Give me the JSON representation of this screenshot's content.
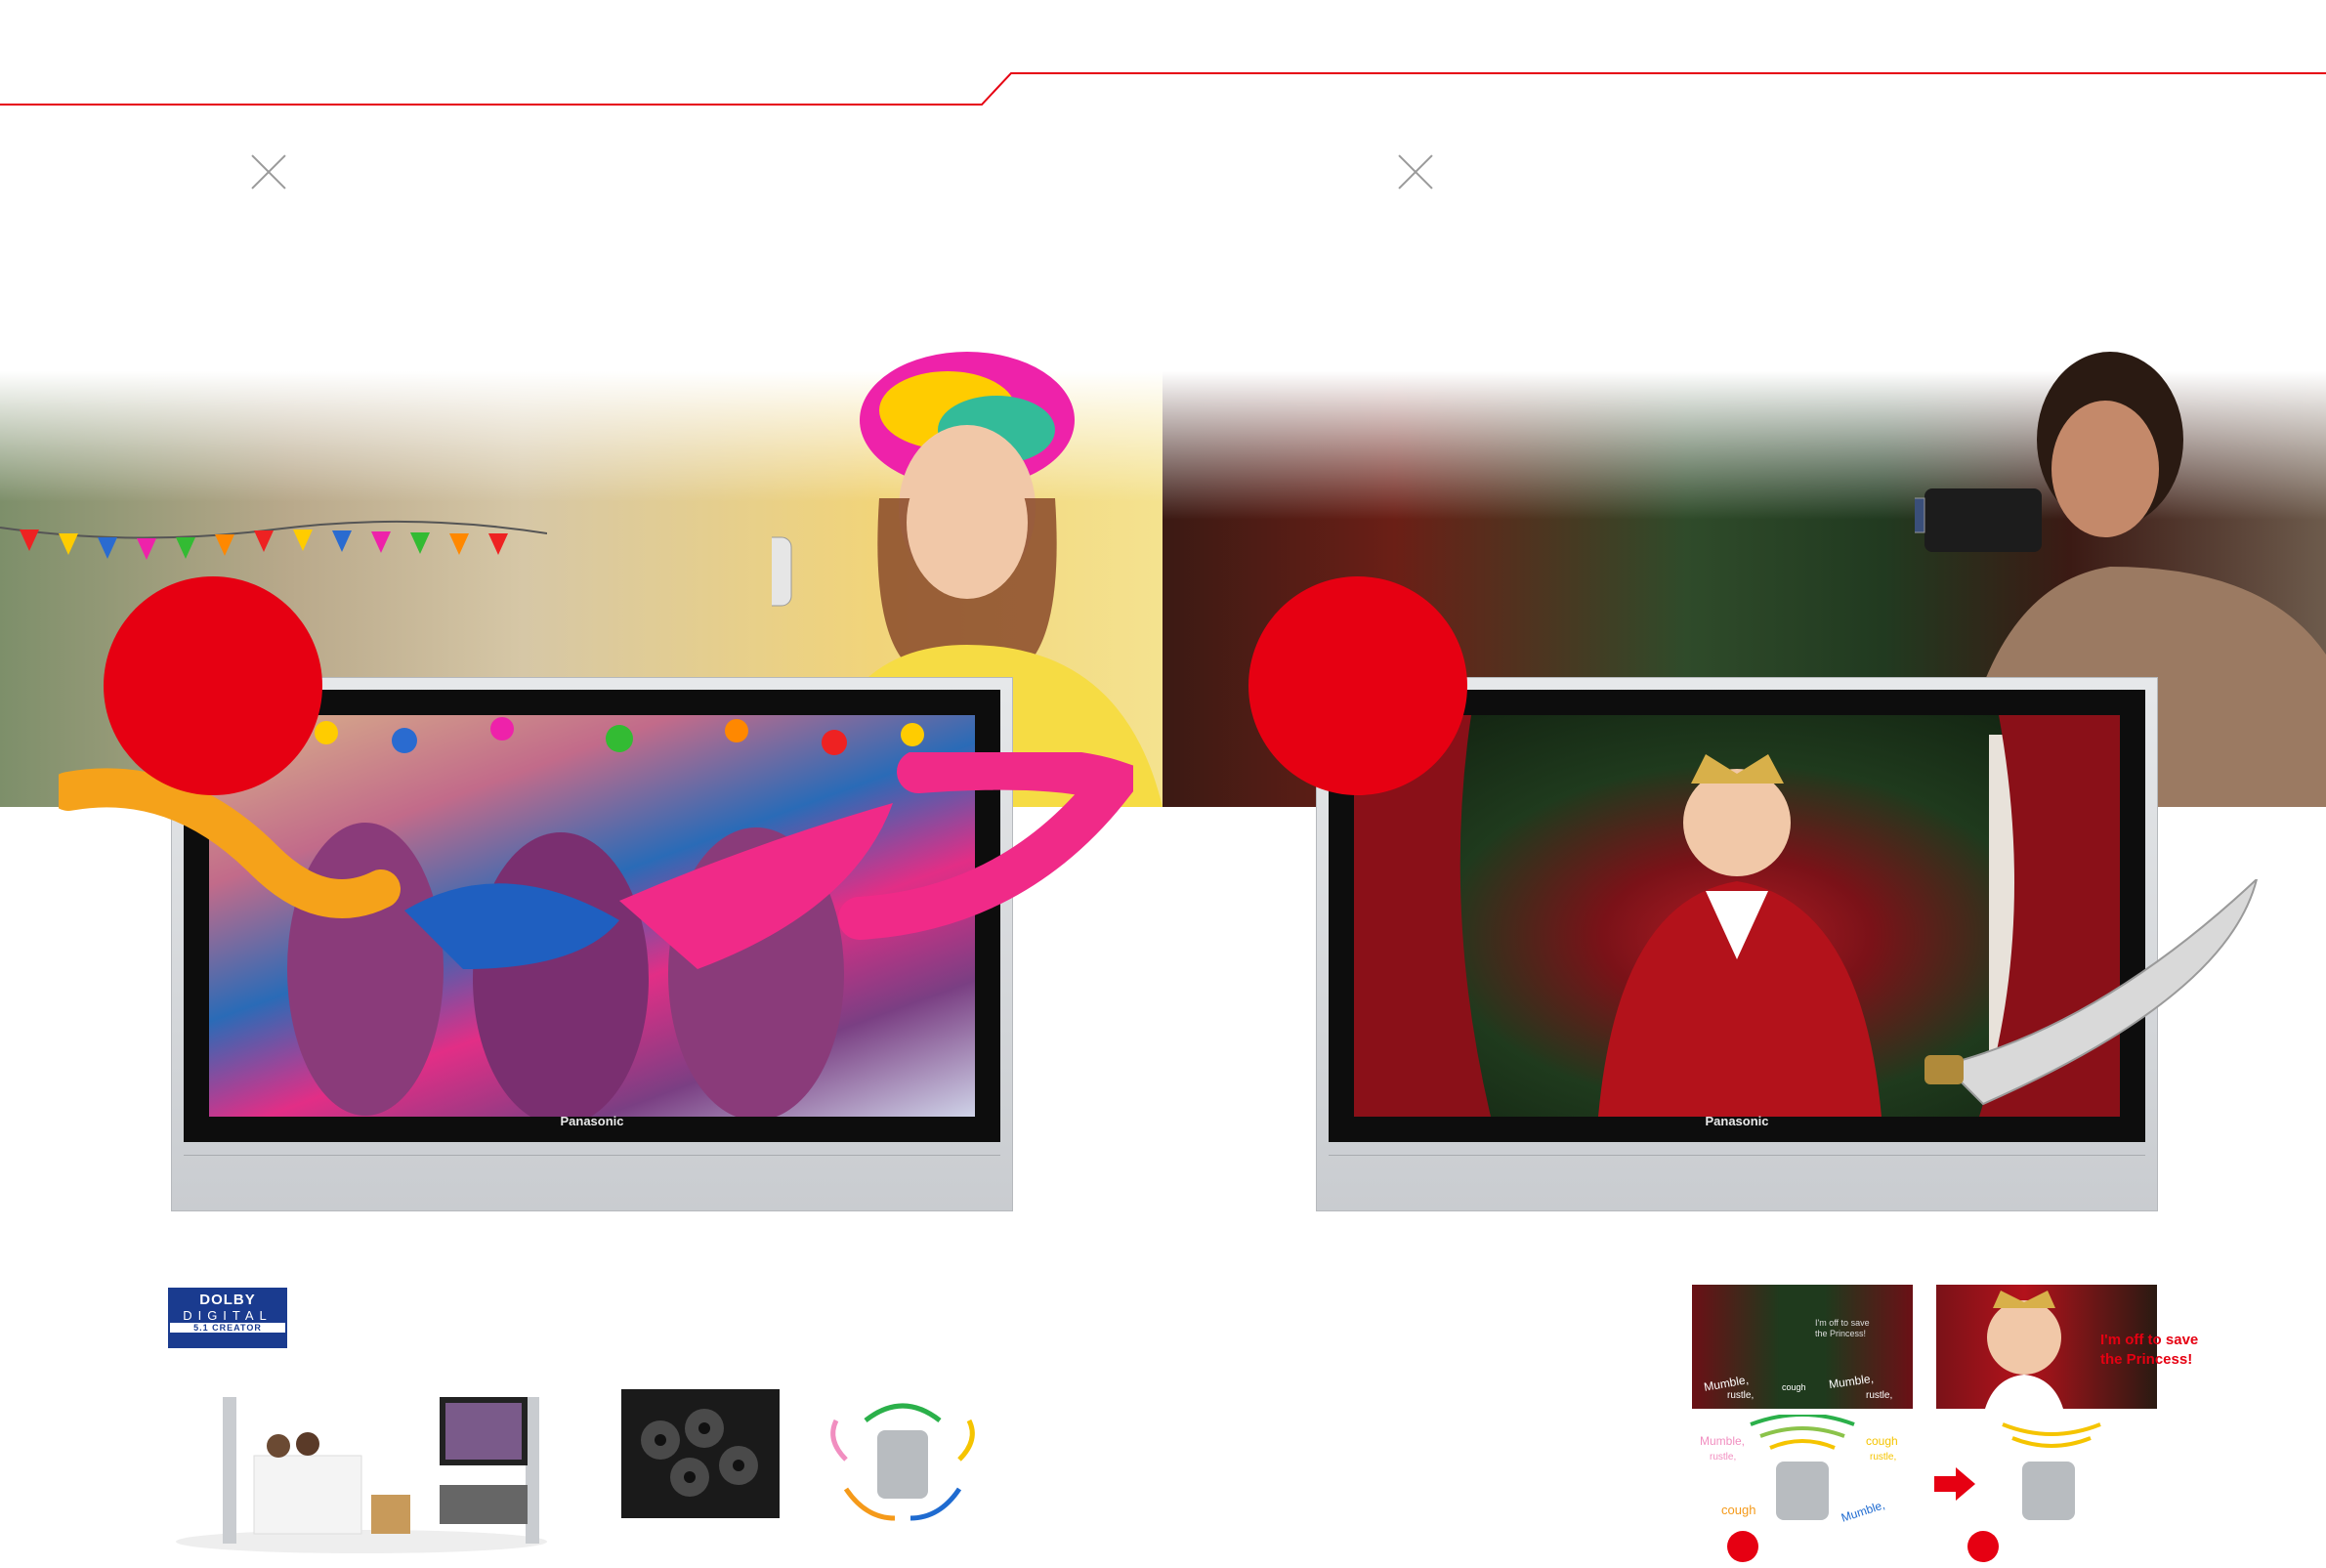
{
  "header": {
    "rule_color": "#e60012"
  },
  "tv": {
    "left": {
      "brand": "Panasonic"
    },
    "right": {
      "brand": "Panasonic"
    }
  },
  "features": {
    "dolby_logo": {
      "line1": "DOLBY",
      "line2": "DIGITAL",
      "line3": "5.1 CREATOR"
    }
  },
  "diagram": {
    "speech_small": "I'm off to save the Princess!",
    "noise_words": [
      "Mumble,",
      "rustle,",
      "cough",
      "Mumble,",
      "rustle,"
    ],
    "noise_words_bottom": [
      "Mumble,",
      "rustle,",
      "cough",
      "rustle,",
      "cough",
      "Mumble,"
    ],
    "speech_large_1": "I'm off to save",
    "speech_large_2": "the Princess!"
  },
  "colors": {
    "accent": "#e60012",
    "dolby_blue": "#1a3b8f"
  }
}
